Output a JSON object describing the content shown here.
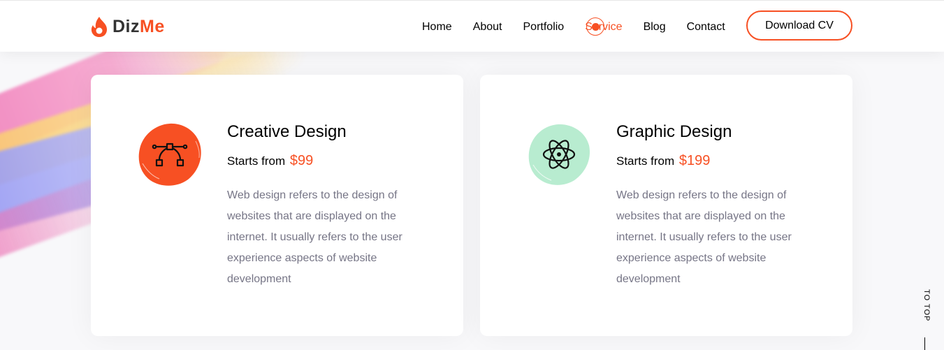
{
  "brand": {
    "part1": "Diz",
    "part2": "Me"
  },
  "colors": {
    "accent": "#f75023",
    "mint": "#b8ecd0",
    "text_muted": "#767586"
  },
  "nav": {
    "items": [
      {
        "label": "Home"
      },
      {
        "label": "About"
      },
      {
        "label": "Portfolio"
      },
      {
        "label": "Service",
        "active": true
      },
      {
        "label": "Blog"
      },
      {
        "label": "Contact"
      }
    ],
    "cta_label": "Download CV"
  },
  "services": [
    {
      "title": "Creative Design",
      "price_prefix": "Starts from",
      "price": "$99",
      "description": "Web design refers to the design of websites that are displayed on the internet. It usually refers to the user experience aspects of website development",
      "icon": "vector-pen-icon",
      "icon_bg": "#f75023"
    },
    {
      "title": "Graphic Design",
      "price_prefix": "Starts from",
      "price": "$199",
      "description": "Web design refers to the design of websites that are displayed on the internet. It usually refers to the user experience aspects of website development",
      "icon": "atom-icon",
      "icon_bg": "#b8ecd0"
    }
  ],
  "totop_label": "TO TOP"
}
